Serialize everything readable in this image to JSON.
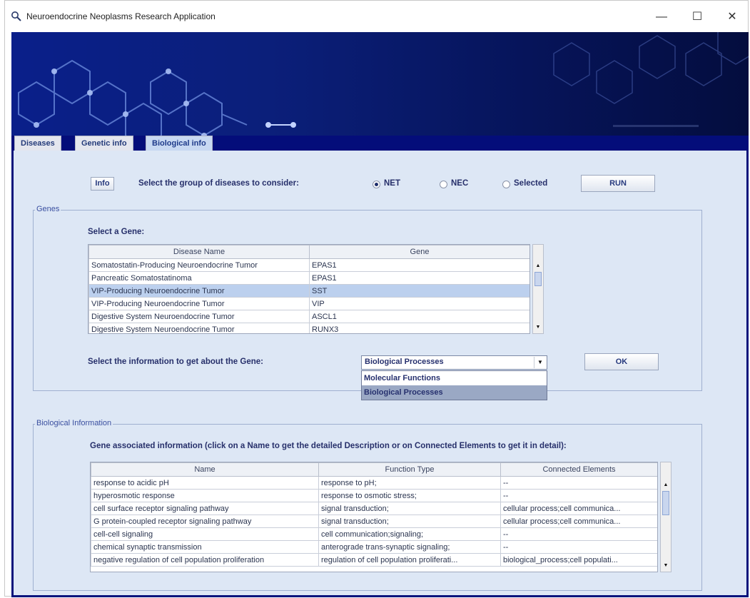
{
  "window": {
    "title": "Neuroendocrine Neoplasms Research Application",
    "minimize": "—",
    "maximize": "☐",
    "close": "✕"
  },
  "tabs": [
    {
      "label": "Diseases",
      "active": false
    },
    {
      "label": "Genetic info",
      "active": false
    },
    {
      "label": "Biological info",
      "active": true
    }
  ],
  "top_bar": {
    "info_button": "Info",
    "prompt": "Select the group of diseases to consider:",
    "radio_options": [
      {
        "label": "NET",
        "checked": true
      },
      {
        "label": "NEC",
        "checked": false
      },
      {
        "label": "Selected",
        "checked": false
      }
    ],
    "run_button": "RUN"
  },
  "genes_group": {
    "title": "Genes",
    "select_label": "Select a Gene:",
    "columns": [
      "Disease Name",
      "Gene"
    ],
    "rows": [
      {
        "disease": "Somatostatin-Producing Neuroendocrine Tumor",
        "gene": "EPAS1",
        "selected": false
      },
      {
        "disease": "Pancreatic Somatostatinoma",
        "gene": "EPAS1",
        "selected": false
      },
      {
        "disease": "VIP-Producing Neuroendocrine Tumor",
        "gene": "SST",
        "selected": true
      },
      {
        "disease": "VIP-Producing Neuroendocrine Tumor",
        "gene": "VIP",
        "selected": false
      },
      {
        "disease": "Digestive System Neuroendocrine Tumor",
        "gene": "ASCL1",
        "selected": false
      },
      {
        "disease": "Digestive System Neuroendocrine Tumor",
        "gene": "RUNX3",
        "selected": false
      }
    ],
    "info_label": "Select the information to get about the Gene:",
    "combo_value": "Biological Processes",
    "combo_options": [
      {
        "label": "Molecular Functions",
        "highlighted": false
      },
      {
        "label": "Biological Processes",
        "highlighted": true
      }
    ],
    "ok_button": "OK"
  },
  "bio_group": {
    "title": "Biological Information",
    "description": "Gene associated information (click on a Name to get the detailed Description or on Connected Elements to get it in detail):",
    "columns": [
      "Name",
      "Function Type",
      "Connected Elements"
    ],
    "rows": [
      {
        "name": "response to acidic pH",
        "type": "response to pH;",
        "connected": "--"
      },
      {
        "name": "hyperosmotic response",
        "type": "response to osmotic stress;",
        "connected": "--"
      },
      {
        "name": "cell surface receptor signaling pathway",
        "type": "signal transduction;",
        "connected": "cellular process;cell communica..."
      },
      {
        "name": "G protein-coupled receptor signaling pathway",
        "type": "signal transduction;",
        "connected": "cellular process;cell communica..."
      },
      {
        "name": "cell-cell signaling",
        "type": "cell communication;signaling;",
        "connected": "--"
      },
      {
        "name": "chemical synaptic transmission",
        "type": "anterograde trans-synaptic signaling;",
        "connected": "--"
      },
      {
        "name": "negative regulation of cell population proliferation",
        "type": "regulation of cell population proliferati...",
        "connected": "biological_process;cell populati..."
      }
    ]
  }
}
